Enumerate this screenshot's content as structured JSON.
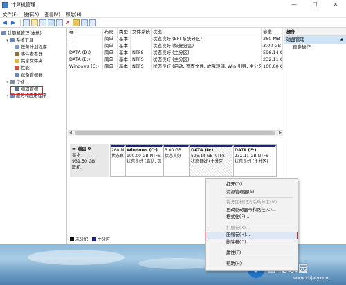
{
  "window": {
    "title": "计算机管理",
    "min": "—",
    "max": "☐",
    "close": "✕"
  },
  "menu": [
    "文件(F)",
    "操作(A)",
    "查看(V)",
    "帮助(H)"
  ],
  "tree": {
    "root": "计算机管理(本地)",
    "items": [
      {
        "label": "系统工具",
        "indent": 1,
        "arrow": "▾",
        "color": "#6b86b0"
      },
      {
        "label": "任务计划程序",
        "indent": 2,
        "arrow": "›",
        "color": "#7f9bbf"
      },
      {
        "label": "事件查看器",
        "indent": 2,
        "arrow": "›",
        "color": "#8c6f4c"
      },
      {
        "label": "共享文件夹",
        "indent": 2,
        "arrow": "›",
        "color": "#d9b44a"
      },
      {
        "label": "性能",
        "indent": 2,
        "arrow": "›",
        "color": "#c9503a"
      },
      {
        "label": "设备管理器",
        "indent": 2,
        "arrow": "",
        "color": "#6a86b5"
      },
      {
        "label": "存储",
        "indent": 1,
        "arrow": "▾",
        "color": "#7d8fa8"
      },
      {
        "label": "磁盘管理",
        "indent": 2,
        "arrow": "",
        "color": "#5b6f8c"
      },
      {
        "label": "服务和应用程序",
        "indent": 1,
        "arrow": "›",
        "color": "#6d8cb6"
      }
    ]
  },
  "volumes": {
    "headers": [
      "卷",
      "布局",
      "类型",
      "文件系统",
      "状态",
      "容量"
    ],
    "rows": [
      [
        "—",
        "简单",
        "基本",
        "",
        "状态良好 (EFI 系统分区)",
        "260 MB"
      ],
      [
        "—",
        "简单",
        "基本",
        "",
        "状态良好 (恢复分区)",
        "3.00 GB"
      ],
      [
        "DATA (D:)",
        "简单",
        "基本",
        "NTFS",
        "状态良好 (主分区)",
        "596.14 G"
      ],
      [
        "DATA (E:)",
        "简单",
        "基本",
        "NTFS",
        "状态良好 (主分区)",
        "232.11 G"
      ],
      [
        "Windows (C:)",
        "简单",
        "基本",
        "NTFS",
        "状态良好 (启动, 页面文件, 故障转储, Win 引导, 主分区)",
        "100.00 G"
      ]
    ]
  },
  "disk": {
    "name": "磁盘 0",
    "type": "基本",
    "size": "931.50 GB",
    "status": "联机",
    "partitions": [
      {
        "name": "",
        "size": "260 M",
        "status": "状态良",
        "selected": false,
        "width": 22
      },
      {
        "name": "Windows (C:)",
        "size": "100.00 GB NTFS",
        "status": "状态良好 (启动, 页",
        "selected": false,
        "width": 55
      },
      {
        "name": "",
        "size": "3.00 GB",
        "status": "状态良好",
        "selected": false,
        "width": 38
      },
      {
        "name": "DATA (D:)",
        "size": "596.14 GB NTFS",
        "status": "状态良好 (主分区)",
        "selected": true,
        "width": 63
      },
      {
        "name": "DATA (E:)",
        "size": "232.11 GB NTFS",
        "status": "状态良好 (主分区)",
        "selected": false,
        "width": 63
      }
    ]
  },
  "legend": [
    {
      "label": "未分配",
      "color": "#111111"
    },
    {
      "label": "主分区",
      "color": "#1a237e"
    }
  ],
  "actions": {
    "title": "操作",
    "selected": "磁盘管理",
    "more": "更多操作"
  },
  "context_menu": [
    {
      "label": "打开(O)",
      "disabled": false
    },
    {
      "label": "资源管理器(E)",
      "disabled": false
    },
    {
      "sep": true
    },
    {
      "label": "将分区标记为活动分区(M)",
      "disabled": true
    },
    {
      "label": "更改驱动器号和路径(C)...",
      "disabled": false
    },
    {
      "label": "格式化(F)...",
      "disabled": false
    },
    {
      "sep": true
    },
    {
      "label": "扩展卷(X)...",
      "disabled": true
    },
    {
      "label": "压缩卷(H)...",
      "disabled": false,
      "highlight": true
    },
    {
      "label": "删除卷(D)...",
      "disabled": false
    },
    {
      "sep": true
    },
    {
      "label": "属性(P)",
      "disabled": false
    },
    {
      "sep": true
    },
    {
      "label": "帮助(H)",
      "disabled": false
    }
  ],
  "watermark": {
    "name": "雪花家园",
    "url": "www.xhjaty.com"
  }
}
